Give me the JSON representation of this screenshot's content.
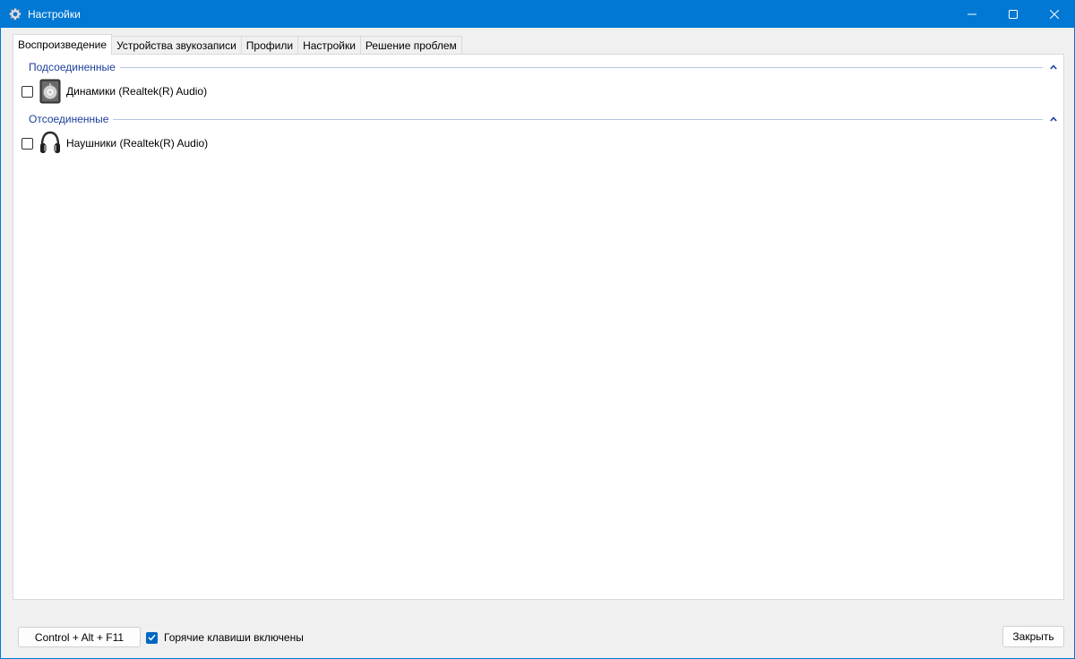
{
  "window": {
    "title": "Настройки",
    "controls": [
      "minimize",
      "maximize",
      "close"
    ],
    "accent_color": "#0078d4"
  },
  "tabs": [
    {
      "label": "Воспроизведение",
      "active": true
    },
    {
      "label": "Устройства звукозаписи",
      "active": false
    },
    {
      "label": "Профили",
      "active": false
    },
    {
      "label": "Настройки",
      "active": false
    },
    {
      "label": "Решение проблем",
      "active": false
    }
  ],
  "groups": [
    {
      "title": "Подсоединенные",
      "devices": [
        {
          "label": "Динамики (Realtek(R) Audio)",
          "icon": "speaker-icon",
          "checked": false
        }
      ]
    },
    {
      "title": "Отсоединенные",
      "devices": [
        {
          "label": "Наушники (Realtek(R) Audio)",
          "icon": "headphones-icon",
          "checked": false
        }
      ]
    }
  ],
  "footer": {
    "hotkey_button": "Control + Alt + F11",
    "hotkeys_enabled_label": "Горячие клавиши включены",
    "hotkeys_enabled": true,
    "close_button": "Закрыть"
  }
}
